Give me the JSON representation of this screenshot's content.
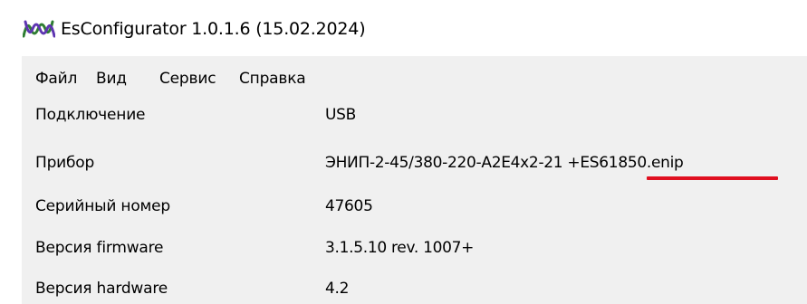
{
  "window": {
    "title": "EsConfigurator 1.0.1.6 (15.02.2024)",
    "icon": "wave-logo-icon"
  },
  "menu": {
    "items": [
      {
        "label": "Файл"
      },
      {
        "label": "Вид"
      },
      {
        "label": "Сервис"
      },
      {
        "label": "Справка"
      }
    ]
  },
  "info": {
    "rows": [
      {
        "label": "Подключение",
        "value": "USB"
      },
      {
        "label": "Прибор",
        "value": "ЭНИП-2-45/380-220-A2E4x2-21 +ES61850.enip"
      },
      {
        "label": "Серийный номер",
        "value": "47605"
      },
      {
        "label": "Версия firmware",
        "value": "3.1.5.10 rev. 1007+"
      },
      {
        "label": "Версия hardware",
        "value": "4.2"
      }
    ]
  },
  "colors": {
    "icon_green": "#2e7d32",
    "icon_purple": "#5e35b1",
    "highlight_red": "#e01020",
    "panel_bg": "#f0f0f0"
  }
}
